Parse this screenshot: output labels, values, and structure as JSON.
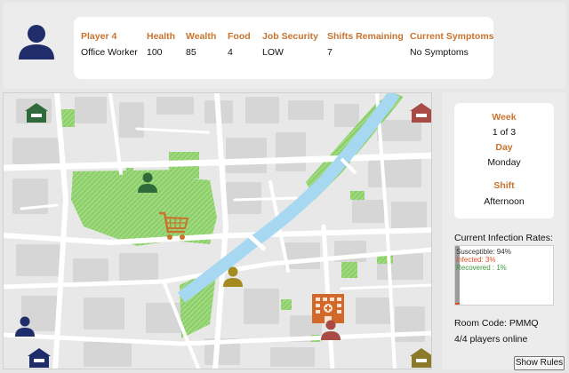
{
  "player": {
    "columns": [
      {
        "header": "Player 4",
        "value": "Office Worker"
      },
      {
        "header": "Health",
        "value": "100"
      },
      {
        "header": "Wealth",
        "value": "85"
      },
      {
        "header": "Food",
        "value": "4"
      },
      {
        "header": "Job Security",
        "value": "LOW"
      },
      {
        "header": "Shifts Remaining",
        "value": "7"
      },
      {
        "header": "Current Symptoms",
        "value": "No Symptoms"
      }
    ],
    "avatar_icon": "person-icon",
    "avatar_color": "#1f2d6b"
  },
  "time": {
    "week_label": "Week",
    "week_value": "1 of 3",
    "day_label": "Day",
    "day_value": "Monday",
    "shift_label": "Shift",
    "shift_value": "Afternoon"
  },
  "infection": {
    "title": "Current Infection Rates:",
    "susceptible": "Susceptible: 94%",
    "infected": "Infected: 3%",
    "recovered": "Recovered : 1%",
    "susceptible_color": "#333333",
    "infected_color": "#e04e26",
    "recovered_color": "#3a9a3a",
    "infected_fraction": 0.03
  },
  "room": {
    "code": "Room Code: PMMQ",
    "players_online": "4/4 players online"
  },
  "buttons": {
    "show_rules": "Show Rules"
  },
  "map": {
    "icons": [
      "house-icon",
      "house-icon",
      "house-icon",
      "house-icon",
      "shopping-cart-icon",
      "hospital-icon",
      "person-icon"
    ],
    "player_colors": [
      "#2f6b3a",
      "#a58a1f",
      "#a84b45",
      "#1f2d6b"
    ],
    "house_colors": [
      "#2f6b3a",
      "#a84b45",
      "#1f2d6b",
      "#8a7a2a"
    ],
    "accent_orange": "#c8742e"
  }
}
